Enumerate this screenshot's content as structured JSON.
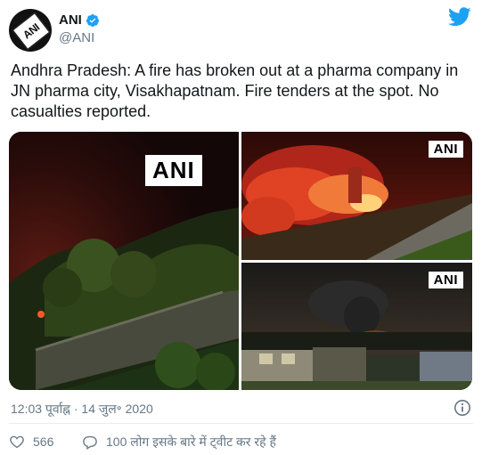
{
  "author": {
    "display_name": "ANI",
    "handle": "@ANI",
    "avatar_text": "ANI",
    "verified": true
  },
  "tweet": {
    "text": "Andhra Pradesh: A fire has broken out at a pharma company in JN pharma city, Visakhapatnam. Fire tenders at the spot. No casualties reported.",
    "timestamp": "12:03 पूर्वाह्न · 14 जुल॰ 2020"
  },
  "media": {
    "watermarks": [
      "ANI",
      "ANI",
      "ANI"
    ]
  },
  "actions": {
    "like_count": "566",
    "conversation_text": "100 लोग इसके बारे में ट्वीट कर रहे हैं"
  },
  "colors": {
    "twitter_blue": "#1da1f2",
    "secondary_text": "#657786",
    "divider": "#e6ecf0"
  },
  "icons": [
    "verified-badge-icon",
    "twitter-bird-icon",
    "info-icon",
    "heart-icon",
    "comment-icon"
  ]
}
